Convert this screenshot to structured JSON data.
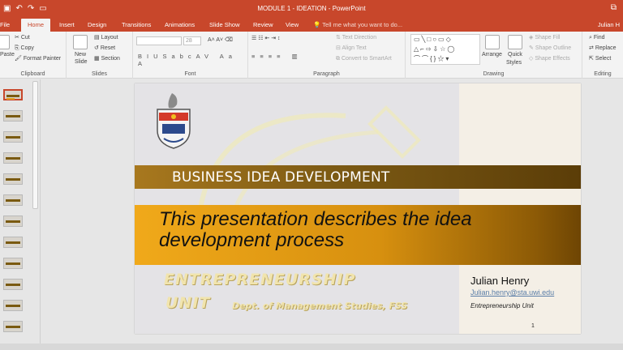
{
  "window": {
    "title": "MODULE 1 - IDEATION - PowerPoint",
    "qat_icons": [
      "save-icon",
      "undo-icon",
      "redo-icon",
      "start-from-beginning-icon"
    ]
  },
  "tabs": [
    {
      "label": "File"
    },
    {
      "label": "Home"
    },
    {
      "label": "Insert"
    },
    {
      "label": "Design"
    },
    {
      "label": "Transitions"
    },
    {
      "label": "Animations"
    },
    {
      "label": "Slide Show"
    },
    {
      "label": "Review"
    },
    {
      "label": "View"
    }
  ],
  "tell_me": "Tell me what you want to do...",
  "user": "Julian H",
  "ribbon": {
    "clipboard": {
      "paste": "Paste",
      "cut": "Cut",
      "copy": "Copy",
      "format_painter": "Format Painter",
      "label": "Clipboard"
    },
    "slides": {
      "new_slide": "New",
      "new_slide2": "Slide",
      "layout": "Layout",
      "reset": "Reset",
      "section": "Section",
      "label": "Slides"
    },
    "font": {
      "font_name": "",
      "font_size": "28",
      "label": "Font"
    },
    "paragraph": {
      "text_direction": "Text Direction",
      "align_text": "Align Text",
      "smartart": "Convert to SmartArt",
      "label": "Paragraph"
    },
    "drawing": {
      "arrange": "Arrange",
      "quick_styles": "Quick",
      "quick_styles2": "Styles",
      "shape_fill": "Shape Fill",
      "shape_outline": "Shape Outline",
      "shape_effects": "Shape Effects",
      "label": "Drawing"
    },
    "editing": {
      "find": "Find",
      "replace": "Replace",
      "select": "Select",
      "label": "Editing"
    }
  },
  "slide": {
    "header": "BUSINESS IDEA DEVELOPMENT",
    "subtitle": "This presentation describes the idea development process",
    "wordart_line1": "ENTREPRENEURSHIP",
    "wordart_line2": "UNIT",
    "department": "Dept. of Management Studies, FSS",
    "author": "Julian Henry",
    "email": "Julian.henry@sta.uwi.edu",
    "unit": "Entrepreneurship Unit",
    "page_number": "1"
  },
  "colors": {
    "accent": "#c8472b",
    "band_dark": "#7c5a14",
    "band_gold": "#f0a91a",
    "wordart": "#f1e4ad"
  }
}
